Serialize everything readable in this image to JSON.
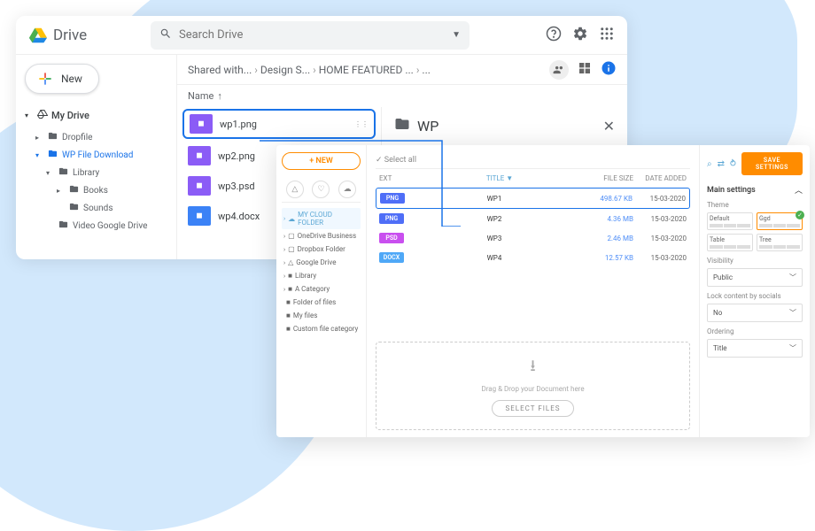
{
  "drive": {
    "brand": "Drive",
    "search_placeholder": "Search Drive",
    "new_button": "New",
    "tree": {
      "root": "My Drive",
      "items": [
        {
          "label": "Dropfile",
          "indent": 1,
          "caret": "▸"
        },
        {
          "label": "WP File Download",
          "indent": 1,
          "caret": "▾",
          "active": true
        },
        {
          "label": "Library",
          "indent": 2,
          "caret": "▾"
        },
        {
          "label": "Books",
          "indent": 3,
          "caret": "▸"
        },
        {
          "label": "Sounds",
          "indent": 3,
          "caret": ""
        },
        {
          "label": "Video Google Drive",
          "indent": 2,
          "caret": ""
        }
      ]
    },
    "breadcrumb": [
      "Shared with...",
      "Design S...",
      "HOME FEATURED ...",
      "..."
    ],
    "col_name": "Name",
    "files": [
      {
        "name": "wp1.png",
        "color": "purple",
        "selected": true
      },
      {
        "name": "wp2.png",
        "color": "purple"
      },
      {
        "name": "wp3.psd",
        "color": "purple"
      },
      {
        "name": "wp4.docx",
        "color": "blue"
      }
    ],
    "detail": {
      "title": "WP"
    }
  },
  "wp": {
    "new_button": "+ NEW",
    "selectall": "✓ Select all",
    "tree": [
      {
        "label": "MY CLOUD FOLDER",
        "active": true,
        "caret": "›",
        "icon": "☁"
      },
      {
        "label": "OneDrive Business",
        "caret": "›",
        "icon": "▢"
      },
      {
        "label": "Dropbox Folder",
        "caret": "›",
        "icon": "▢"
      },
      {
        "label": "Google Drive",
        "caret": "›",
        "icon": "△"
      },
      {
        "label": "Library",
        "caret": "›",
        "icon": "■"
      },
      {
        "label": "A Category",
        "caret": "›",
        "icon": "■"
      },
      {
        "label": "Folder of files",
        "caret": "",
        "icon": "■"
      },
      {
        "label": "My files",
        "caret": "",
        "icon": "■"
      },
      {
        "label": "Custom file category",
        "caret": "",
        "icon": "■"
      }
    ],
    "cols": {
      "ext": "EXT",
      "title": "TITLE ▼",
      "size": "FILE SIZE",
      "date": "DATE ADDED"
    },
    "rows": [
      {
        "ext": "PNG",
        "badge": "png",
        "title": "WP1",
        "size": "498.67 KB",
        "date": "15-03-2020",
        "selected": true
      },
      {
        "ext": "PNG",
        "badge": "png",
        "title": "WP2",
        "size": "4.36 MB",
        "date": "15-03-2020"
      },
      {
        "ext": "PSD",
        "badge": "psd",
        "title": "WP3",
        "size": "2.46 MB",
        "date": "15-03-2020"
      },
      {
        "ext": "DOCX",
        "badge": "docx",
        "title": "WP4",
        "size": "12.57 KB",
        "date": "15-03-2020"
      }
    ],
    "drop": {
      "text": "Drag & Drop your Document here",
      "button": "SELECT FILES"
    },
    "settings": {
      "save": "SAVE SETTINGS",
      "main": "Main settings",
      "theme_label": "Theme",
      "themes": [
        "Default",
        "Ggd",
        "Table",
        "Tree"
      ],
      "visibility_label": "Visibility",
      "visibility": "Public",
      "lock_label": "Lock content by socials",
      "lock": "No",
      "ordering_label": "Ordering",
      "ordering": "Title"
    }
  }
}
